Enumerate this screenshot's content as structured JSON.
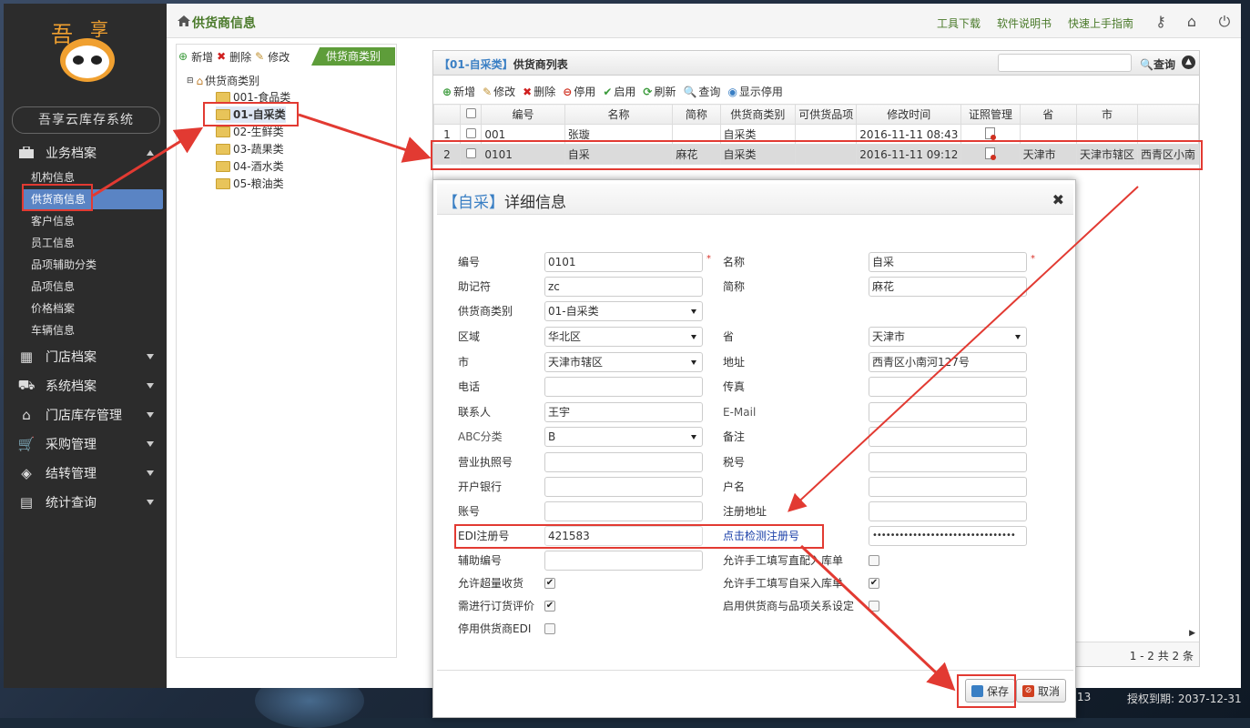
{
  "sidebar": {
    "app_title": "吾享云库存系统",
    "sections": [
      {
        "label": "业务档案",
        "icon": "briefcase-icon",
        "expanded": true
      },
      {
        "label": "门店档案",
        "icon": "store-icon"
      },
      {
        "label": "系统档案",
        "icon": "truck-icon"
      },
      {
        "label": "门店库存管理",
        "icon": "house-icon"
      },
      {
        "label": "采购管理",
        "icon": "cart-icon"
      },
      {
        "label": "结转管理",
        "icon": "layers-icon"
      },
      {
        "label": "统计查询",
        "icon": "chart-icon"
      }
    ],
    "sub_items": [
      "机构信息",
      "供货商信息",
      "客户信息",
      "员工信息",
      "品项辅助分类",
      "品项信息",
      "价格档案",
      "车辆信息"
    ],
    "active_sub": "供货商信息"
  },
  "topbar": {
    "title": "供货商信息",
    "links": [
      "工具下载",
      "软件说明书",
      "快速上手指南"
    ]
  },
  "left_panel": {
    "tools": [
      "新增",
      "删除",
      "修改"
    ],
    "tag": "供货商类别",
    "tree_root": "供货商类别",
    "tree_items": [
      "001-食品类",
      "01-自采类",
      "02-生鲜类",
      "03-蔬果类",
      "04-酒水类",
      "05-粮油类"
    ]
  },
  "grid": {
    "title_prefix": "【01-自采类】",
    "title": "供货商列表",
    "search_btn": "查询",
    "tools": [
      "新增",
      "修改",
      "删除",
      "停用",
      "启用",
      "刷新",
      "查询",
      "显示停用"
    ],
    "columns": [
      "编号",
      "名称",
      "简称",
      "供货商类别",
      "可供货品项",
      "修改时间",
      "证照管理",
      "省",
      "市"
    ],
    "rows": [
      {
        "n": "1",
        "code": "001",
        "name": "张璇",
        "abbr": "",
        "cat": "自采类",
        "items": "",
        "time": "2016-11-11 08:43",
        "prov": "",
        "city": "",
        "addr": ""
      },
      {
        "n": "2",
        "code": "0101",
        "name": "自采",
        "abbr": "麻花",
        "cat": "自采类",
        "items": "",
        "time": "2016-11-11 09:12",
        "prov": "天津市",
        "city": "天津市辖区",
        "addr": "西青区小南"
      }
    ],
    "pager": "1 - 2   共 2 条"
  },
  "dialog": {
    "title_bracket": "【自采】",
    "title": "详细信息",
    "fields": {
      "code_l": "编号",
      "code_v": "0101",
      "name_l": "名称",
      "name_v": "自采",
      "mnem_l": "助记符",
      "mnem_v": "zc",
      "abbr_l": "简称",
      "abbr_v": "麻花",
      "cat_l": "供货商类别",
      "cat_v": "01-自采类",
      "region_l": "区域",
      "region_v": "华北区",
      "prov_l": "省",
      "prov_v": "天津市",
      "city_l": "市",
      "city_v": "天津市辖区",
      "addr_l": "地址",
      "addr_v": "西青区小南河127号",
      "phone_l": "电话",
      "fax_l": "传真",
      "contact_l": "联系人",
      "contact_v": "王宇",
      "email_l": "E-Mail",
      "abc_l": "ABC分类",
      "abc_v": "B",
      "remark_l": "备注",
      "license_l": "营业执照号",
      "tax_l": "税号",
      "bank_l": "开户银行",
      "holder_l": "户名",
      "acct_l": "账号",
      "regaddr_l": "注册地址",
      "edi_l": "EDI注册号",
      "edi_v": "421583",
      "edi_check": "点击检测注册号",
      "edi_pwd": "••••••••••••••••••••••••••••••••",
      "aux_l": "辅助编号",
      "allow_manual_direct": "允许手工填写直配入库单",
      "allow_over": "允许超量收货",
      "allow_manual_self": "允许手工填写自采入库单",
      "need_eval": "需进行订货评价",
      "enable_rel": "启用供货商与品项关系设定",
      "disable_edi": "停用供货商EDI"
    },
    "save": "保存",
    "cancel": "取消"
  },
  "bottom": {
    "left": "13",
    "right": "授权到期: 2037-12-31"
  }
}
